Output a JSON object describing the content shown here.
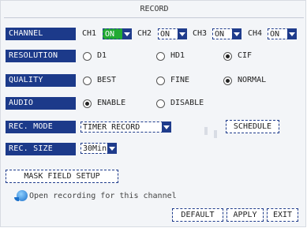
{
  "window": {
    "title": "RECORD"
  },
  "channel": {
    "label": "CHANNEL",
    "items": [
      {
        "name": "CH1",
        "value": "ON"
      },
      {
        "name": "CH2",
        "value": "ON"
      },
      {
        "name": "CH3",
        "value": "ON"
      },
      {
        "name": "CH4",
        "value": "ON"
      }
    ]
  },
  "resolution": {
    "label": "RESOLUTION",
    "options": [
      "D1",
      "HD1",
      "CIF"
    ],
    "selected": "CIF"
  },
  "quality": {
    "label": "QUALITY",
    "options": [
      "BEST",
      "FINE",
      "NORMAL"
    ],
    "selected": "NORMAL"
  },
  "audio": {
    "label": "AUDIO",
    "options": [
      "ENABLE",
      "DISABLE"
    ],
    "selected": "ENABLE"
  },
  "rec_mode": {
    "label": "REC. MODE",
    "value": "TIMER RECORD",
    "schedule_label": "SCHEDULE"
  },
  "rec_size": {
    "label": "REC. SIZE",
    "value": "30Min"
  },
  "mask_button": "MASK FIELD SETUP",
  "hint": "Open recording for this channel",
  "buttons": {
    "default": "DEFAULT",
    "apply": "APPLY",
    "exit": "EXIT"
  },
  "colors": {
    "label_bg": "#1c3a8a",
    "active_bg": "#22aa33",
    "panel_bg": "#f3f5f8"
  }
}
